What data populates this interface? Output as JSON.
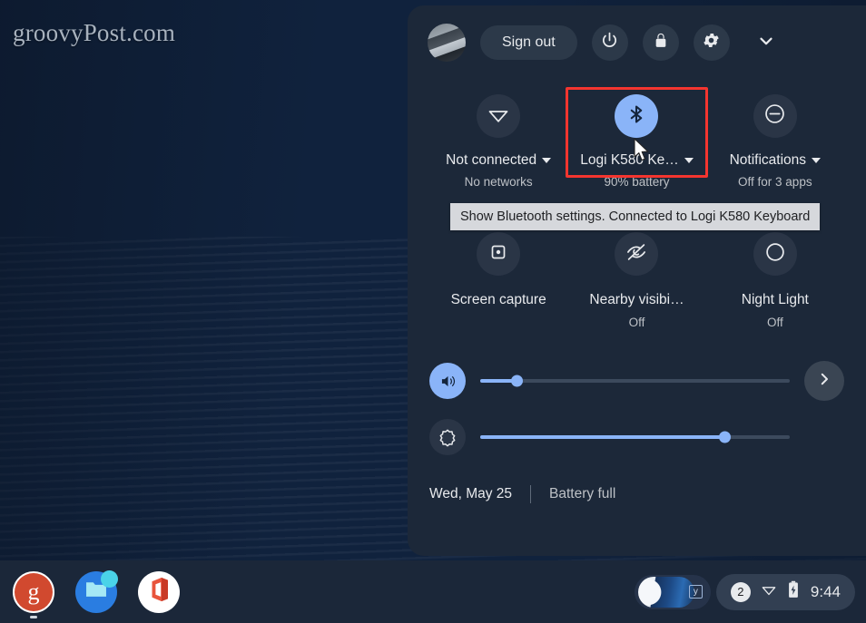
{
  "watermark": "groovyPost.com",
  "panel": {
    "header": {
      "avatar_name": "user-avatar",
      "sign_out_label": "Sign out",
      "power_icon": "power-icon",
      "lock_icon": "lock-icon",
      "settings_icon": "gear-icon",
      "collapse_icon": "chevron-down-icon"
    },
    "tiles_row1": [
      {
        "id": "network",
        "icon": "wifi-off-icon",
        "label": "Not connected",
        "sublabel": "No networks",
        "has_caret": true,
        "active": false
      },
      {
        "id": "bluetooth",
        "icon": "bluetooth-icon",
        "label": "Logi K580 Ke…",
        "sublabel": "90% battery",
        "has_caret": true,
        "active": true
      },
      {
        "id": "notifications",
        "icon": "do-not-disturb-icon",
        "label": "Notifications",
        "sublabel": "Off for 3 apps",
        "has_caret": true,
        "active": false
      }
    ],
    "tiles_row2": [
      {
        "id": "screen-capture",
        "icon": "screen-capture-icon",
        "label": "Screen capture",
        "sublabel": "",
        "active": false
      },
      {
        "id": "nearby-visibility",
        "icon": "eye-off-icon",
        "label": "Nearby visibi…",
        "sublabel": "Off",
        "active": false
      },
      {
        "id": "night-light",
        "icon": "moon-icon",
        "label": "Night Light",
        "sublabel": "Off",
        "active": false
      }
    ],
    "tooltip": {
      "text": "Show Bluetooth settings. Connected to Logi K580 Keyboard"
    },
    "highlight_color": "#f4352f",
    "sliders": [
      {
        "id": "volume",
        "icon": "volume-icon",
        "value": 12,
        "active": true,
        "next_icon": "chevron-right-icon"
      },
      {
        "id": "brightness",
        "icon": "brightness-icon",
        "value": 79,
        "active": false
      }
    ],
    "footer": {
      "date": "Wed, May 25",
      "battery": "Battery full"
    }
  },
  "shelf": {
    "apps": [
      {
        "id": "groovypost",
        "icon": "groovypost-icon",
        "glyph": "g",
        "running": true
      },
      {
        "id": "files",
        "icon": "files-folder-icon",
        "glyph": "",
        "running": false
      },
      {
        "id": "office",
        "icon": "office-icon",
        "glyph": "",
        "running": false
      }
    ],
    "window_preview": {
      "name": "window-preview",
      "badge": "y"
    },
    "tray": {
      "count": "2",
      "wifi_icon": "wifi-icon",
      "battery_icon": "battery-icon",
      "time": "9:44"
    }
  },
  "colors": {
    "panel_bg": "#1c2839",
    "accent": "#8ab4f8",
    "highlight": "#f4352f"
  }
}
